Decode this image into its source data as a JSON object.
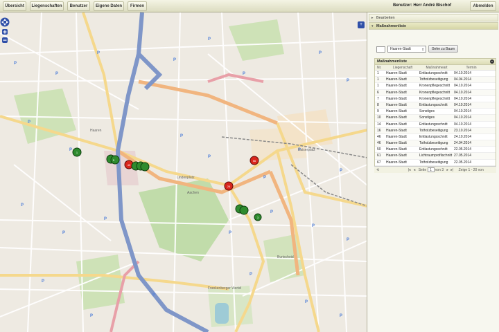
{
  "nav": {
    "tabs": [
      "Übersicht",
      "Liegenschaften",
      "Benutzer",
      "Eigene Daten",
      "Firmen"
    ],
    "user": "Benutzer: Herr André Bischof",
    "logout": "Abmelden"
  },
  "panel": {
    "accordion_edit": "Bearbeiten",
    "accordion_measures": "Maßnahmenliste",
    "filter_value": "Haaren-Stadt",
    "tree_button": "Gehe zu Baum",
    "list": {
      "title": "Maßnahmenliste",
      "headers": [
        "Nr.",
        "Liegenschaft",
        "Maßnahmeart",
        "Termin"
      ],
      "rows": [
        [
          "1",
          "Haaren-Stadt",
          "Entlastungsschnitt",
          "04.10.2014"
        ],
        [
          "1",
          "Haaren-Stadt",
          "Totholzbeseitigung",
          "04.04.2014"
        ],
        [
          "1",
          "Haaren-Stadt",
          "Kronenpflegeschnitt",
          "04.10.2014"
        ],
        [
          "6",
          "Haaren-Stadt",
          "Kronenpflegeschnitt",
          "04.10.2014"
        ],
        [
          "7",
          "Haaren-Stadt",
          "Kronenpflegeschnitt",
          "04.10.2014"
        ],
        [
          "8",
          "Haaren-Stadt",
          "Entlastungsschnitt",
          "04.10.2014"
        ],
        [
          "9",
          "Haaren-Stadt",
          "Sonstiges",
          "04.10.2014"
        ],
        [
          "10",
          "Haaren-Stadt",
          "Sonstiges",
          "04.10.2014"
        ],
        [
          "14",
          "Haaren-Stadt",
          "Entlastungsschnitt",
          "04.10.2014"
        ],
        [
          "16",
          "Haaren-Stadt",
          "Totholzbeseitigung",
          "23.10.2014"
        ],
        [
          "46",
          "Haaren-Stadt",
          "Entlastungsschnitt",
          "24.10.2014"
        ],
        [
          "46",
          "Haaren-Stadt",
          "Totholzbeseitigung",
          "24.04.2014"
        ],
        [
          "50",
          "Haaren-Stadt",
          "Entlastungsschnitt",
          "22.05.2014"
        ],
        [
          "61",
          "Haaren-Stadt",
          "Lichtraumprofilschnitt",
          "27.05.2014"
        ],
        [
          "67",
          "Haaren-Stadt",
          "Totholzbeseitigung",
          "22.05.2014"
        ]
      ]
    },
    "pager": {
      "page_label": "Seite",
      "page_value": "1",
      "of_label": "von 3",
      "summary": "Zeige 1 - 20 von"
    }
  },
  "map": {
    "labels": [
      "Haaren",
      "Lindenplatz",
      "Aachen",
      "Kaiserplatz",
      "Burtscheid",
      "Frankenberger Viertel"
    ],
    "markers": [
      {
        "color": "#2e8b2e",
        "label": "1"
      },
      {
        "color": "#2e8b2e",
        "label": "5"
      },
      {
        "color": "#d9261c",
        "label": "43"
      },
      {
        "color": "#d9261c",
        "label": "56"
      },
      {
        "color": "#d9261c",
        "label": "26"
      },
      {
        "color": "#2e8b2e",
        "label": "3"
      }
    ]
  }
}
